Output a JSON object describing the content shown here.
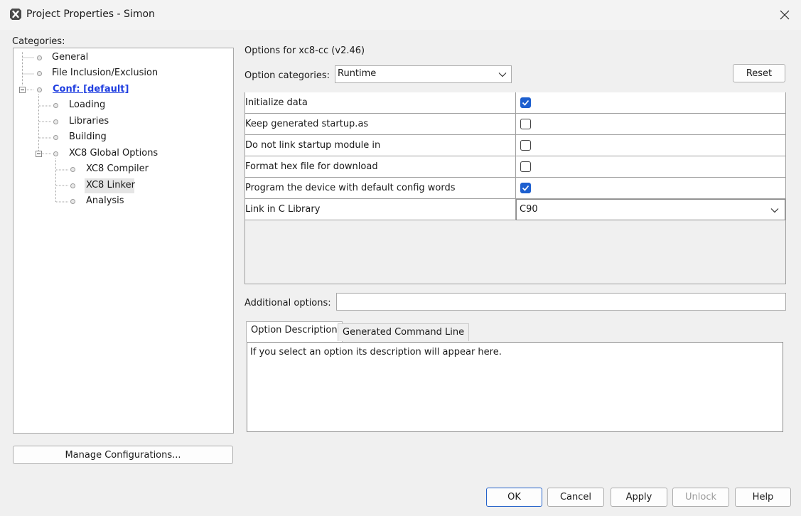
{
  "window": {
    "title": "Project Properties - Simon",
    "app_icon": "x-logo-icon",
    "close_icon": "close-icon"
  },
  "categories": {
    "label": "Categories:",
    "tree": [
      {
        "id": "general",
        "label": "General"
      },
      {
        "id": "file-inclusion",
        "label": "File Inclusion/Exclusion"
      },
      {
        "id": "conf",
        "label": "Conf: [default]",
        "expanded": true
      },
      {
        "id": "loading",
        "label": "Loading"
      },
      {
        "id": "libraries",
        "label": "Libraries"
      },
      {
        "id": "building",
        "label": "Building"
      },
      {
        "id": "xc8-global",
        "label": "XC8 Global Options",
        "expanded": true
      },
      {
        "id": "xc8-compiler",
        "label": "XC8 Compiler"
      },
      {
        "id": "xc8-linker",
        "label": "XC8 Linker",
        "selected": true
      },
      {
        "id": "analysis",
        "label": "Analysis"
      }
    ],
    "manage_button": "Manage Configurations..."
  },
  "options": {
    "header": "Options for xc8-cc (v2.46)",
    "category_label": "Option categories:",
    "category_value": "Runtime",
    "reset_button": "Reset",
    "rows": [
      {
        "name": "Initialize data",
        "type": "checkbox",
        "checked": true
      },
      {
        "name": "Keep generated startup.as",
        "type": "checkbox",
        "checked": false
      },
      {
        "name": "Do not link startup module in",
        "type": "checkbox",
        "checked": false
      },
      {
        "name": "Format hex file for download",
        "type": "checkbox",
        "checked": false
      },
      {
        "name": "Program the device with default config words",
        "type": "checkbox",
        "checked": true
      },
      {
        "name": "Link in C Library",
        "type": "select",
        "value": "C90"
      }
    ],
    "additional_label": "Additional options:",
    "additional_value": "",
    "tabs": [
      "Option Description",
      "Generated Command Line"
    ],
    "active_tab": 0,
    "description": "If you select an option its description will appear here."
  },
  "footer": {
    "ok": "OK",
    "cancel": "Cancel",
    "apply": "Apply",
    "unlock": "Unlock",
    "help": "Help"
  },
  "colors": {
    "link_blue": "#1f3ee0",
    "check_blue": "#1d5fcf",
    "primary_border": "#2563c9"
  }
}
